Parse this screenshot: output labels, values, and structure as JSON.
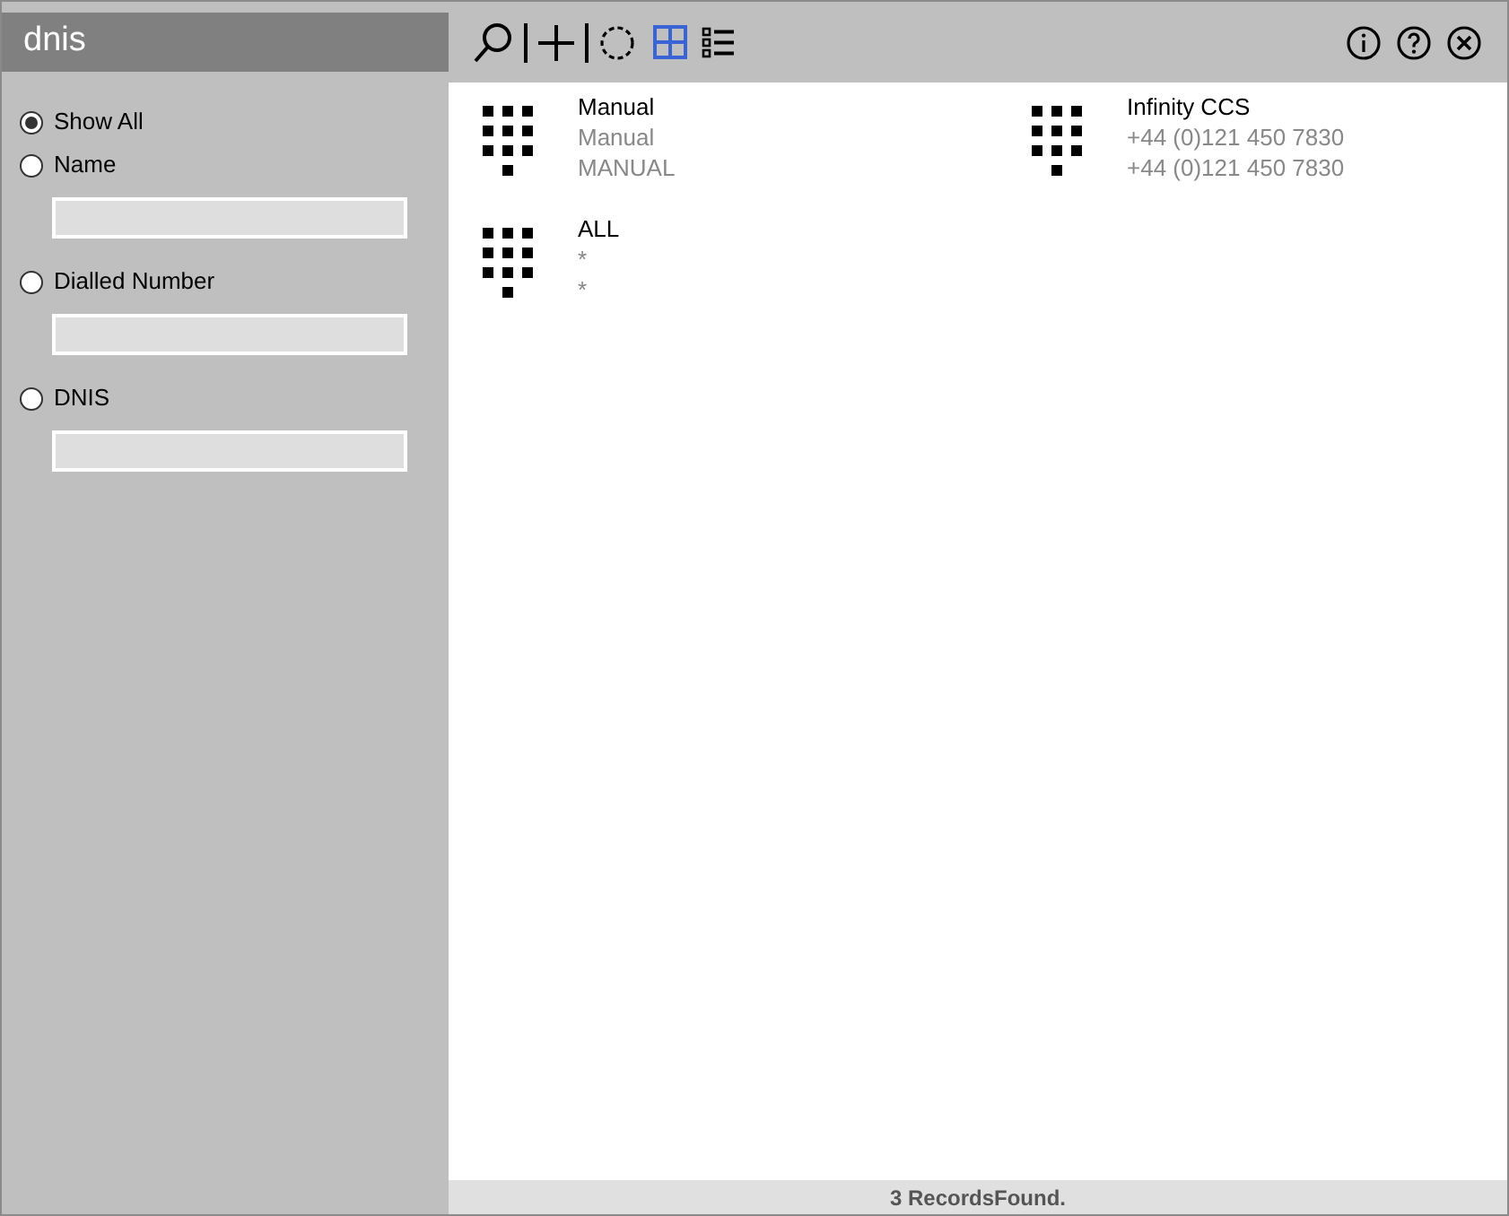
{
  "panel": {
    "title": "dnis"
  },
  "filters": [
    {
      "label": "Show All",
      "selected": true,
      "kind": "plain"
    },
    {
      "label": "Name",
      "selected": false,
      "kind": "with_field"
    },
    {
      "label": "Dialled Number",
      "selected": false,
      "kind": "with_field"
    },
    {
      "label": "DNIS",
      "selected": false,
      "kind": "with_field"
    }
  ],
  "views": [
    {
      "kind": "grid",
      "selected": true
    },
    {
      "kind": "list",
      "selected": false
    }
  ],
  "records": [
    {
      "name": "Manual",
      "line_1": "Manual",
      "line_2": "MANUAL"
    },
    {
      "name": "Infinity CCS",
      "line_1": "+44 (0)121 450 7830",
      "line_2": "+44 (0)121 450 7830"
    },
    {
      "name": "ALL",
      "line_1": "*",
      "line_2": "*"
    }
  ],
  "status_bar": "3 RecordsFound."
}
